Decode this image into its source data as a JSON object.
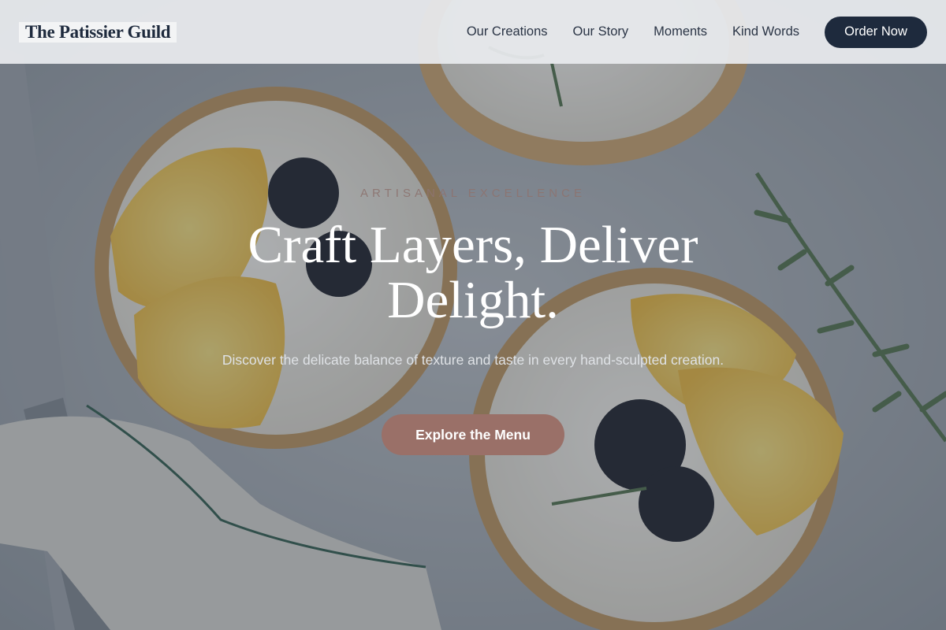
{
  "brand": {
    "name": "The Patissier Guild"
  },
  "nav": {
    "links": [
      {
        "label": "Our Creations"
      },
      {
        "label": "Our Story"
      },
      {
        "label": "Moments"
      },
      {
        "label": "Kind Words"
      }
    ],
    "cta_label": "Order Now"
  },
  "hero": {
    "eyebrow": "ARTISANAL EXCELLENCE",
    "headline": "Craft Layers, Deliver Delight.",
    "subtext": "Discover the delicate balance of texture and taste in every hand-sculpted creation.",
    "cta_label": "Explore the Menu"
  },
  "colors": {
    "primary": "#1e2a3d",
    "accent": "#9a7068",
    "header_bg": "#e8eaed"
  },
  "icons": {
    "hero_image": "tarts-photo"
  }
}
